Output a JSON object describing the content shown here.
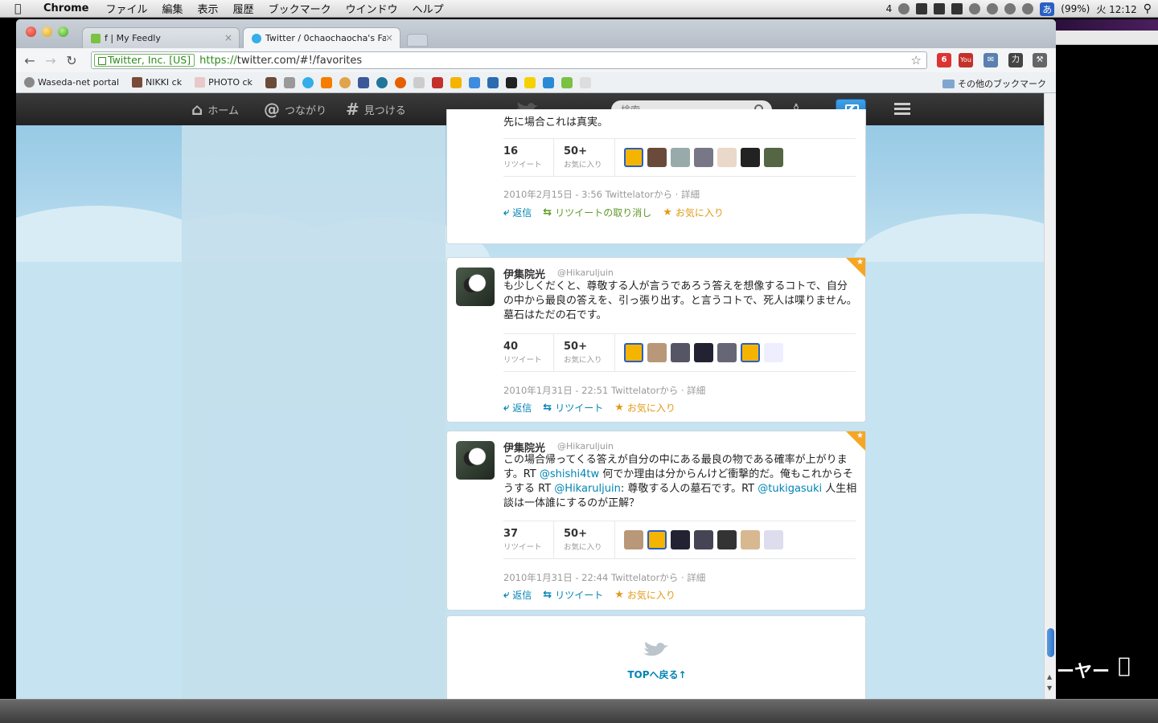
{
  "menubar": {
    "app": "Chrome",
    "items": [
      "ファイル",
      "編集",
      "表示",
      "履歴",
      "ブックマーク",
      "ウインドウ",
      "ヘルプ"
    ],
    "right": {
      "notif_count": "4",
      "battery": "(99%)",
      "clock": "火 12:12",
      "ime": "あ"
    }
  },
  "browser": {
    "tabs": [
      {
        "title": "f | My Feedly",
        "active": false
      },
      {
        "title": "Twitter / 0chaochaocha's Fa",
        "active": true
      }
    ],
    "omnibox": {
      "ev_label": "Twitter, Inc. [US]",
      "scheme": "https://",
      "rest": "twitter.com/#!/favorites"
    },
    "ext_badge": "6",
    "bookmarks": [
      {
        "label": "Waseda-net portal"
      },
      {
        "label": "NIKKI ck"
      },
      {
        "label": "PHOTO ck"
      }
    ],
    "other_bookmarks": "その他のブックマーク"
  },
  "twitter": {
    "nav": {
      "home": "ホーム",
      "connect": "つながり",
      "discover": "見つける"
    },
    "search_placeholder": "検索",
    "partial_text": "先に場合これは真実。",
    "tweets": [
      {
        "retweets": "16",
        "favorites": "50+",
        "rt_label": "リツイート",
        "fav_label": "お気に入り",
        "meta": "2010年2月15日 - 3:56 Twittelatorから · 詳細",
        "reply": "返信",
        "retweet": "リツイートの取り消し",
        "favorite": "お気に入り"
      },
      {
        "name": "伊集院光",
        "handle": "@Hikaruljuin",
        "text": "も少しくだくと、尊敬する人が言うであろう答えを想像するコトで、自分の中から最良の答えを、引っ張り出す。と言うコトで、死人は喋りません。墓石はただの石です。",
        "retweets": "40",
        "favorites": "50+",
        "rt_label": "リツイート",
        "fav_label": "お気に入り",
        "meta": "2010年1月31日 - 22:51 Twittelatorから · 詳細",
        "reply": "返信",
        "retweet": "リツイート",
        "favorite": "お気に入り"
      },
      {
        "name": "伊集院光",
        "handle": "@Hikaruljuin",
        "text_1": "この場合帰ってくる答えが自分の中にある最良の物である確率が上がります。RT ",
        "mention_1": "@shishi4tw",
        "text_2": " 何でか理由は分からんけど衝撃的だ。俺もこれからそうする RT ",
        "mention_2": "@Hikaruljuin",
        "text_3": ": 尊敬する人の墓石です。RT ",
        "mention_3": "@tukigasuki",
        "text_4": " 人生相談は一体誰にするのが正解？",
        "retweets": "37",
        "favorites": "50+",
        "rt_label": "リツイート",
        "fav_label": "お気に入り",
        "meta": "2010年1月31日 - 22:44 Twittelatorから · 詳細",
        "reply": "返信",
        "retweet": "リツイート",
        "favorite": "お気に入り"
      }
    ],
    "back_to_top": "TOPへ戻る↑"
  },
  "desktop": {
    "label": "ーヤー"
  },
  "colors": {
    "twitter_link": "#0084b4",
    "favorite": "#e09b16",
    "retweet_done": "#609928",
    "topbar": "#2b2b2b"
  }
}
